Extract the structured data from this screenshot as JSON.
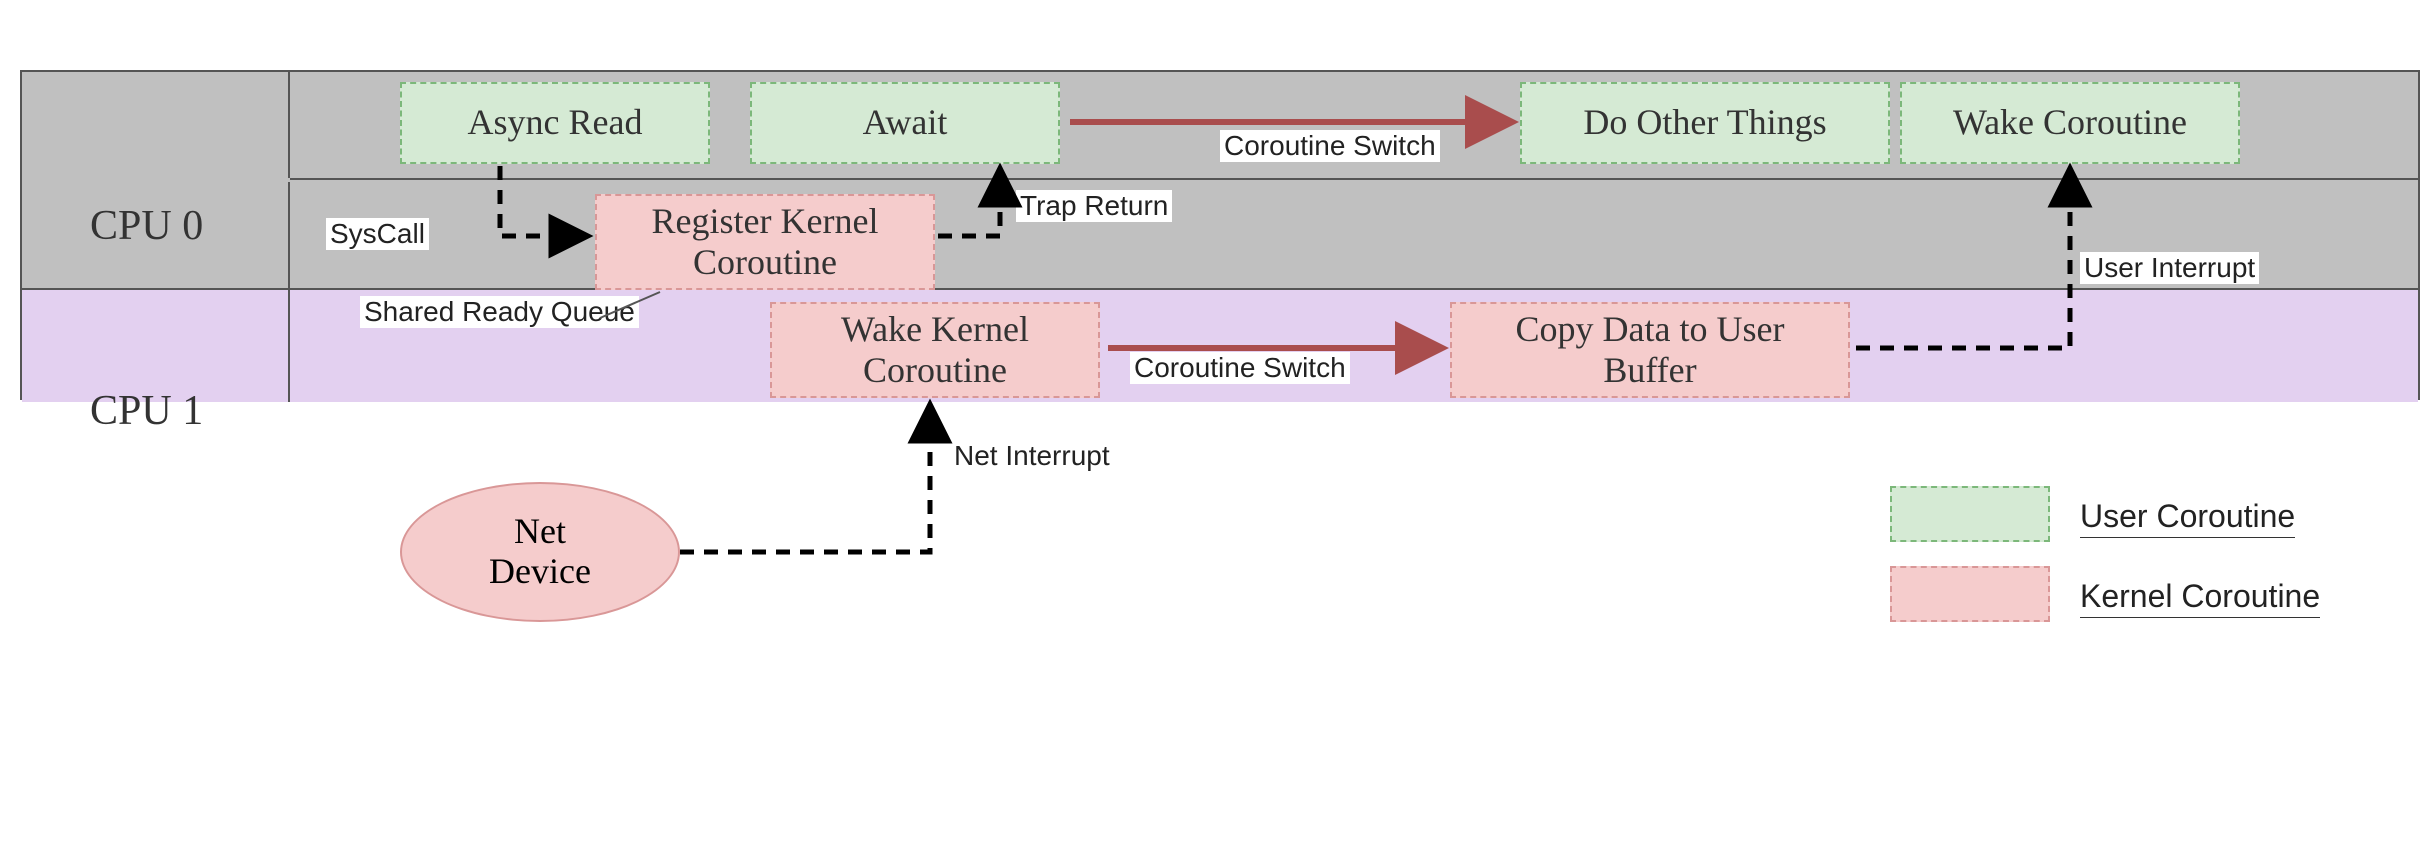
{
  "cpu0": "CPU 0",
  "cpu1": "CPU 1",
  "boxes": {
    "async_read": "Async Read",
    "await": "Await",
    "do_other": "Do Other Things",
    "wake_cor": "Wake Coroutine",
    "reg_kernel": "Register Kernel\nCoroutine",
    "wake_kernel": "Wake Kernel\nCoroutine",
    "copy_data": "Copy Data to User\nBuffer"
  },
  "labels": {
    "syscall": "SysCall",
    "trap_return": "Trap Return",
    "cor_switch1": "Coroutine Switch",
    "cor_switch2": "Coroutine Switch",
    "shared_queue": "Shared Ready Queue",
    "net_interrupt": "Net Interrupt",
    "user_interrupt": "User Interrupt"
  },
  "net_device": "Net\nDevice",
  "legend": {
    "user": "User Coroutine",
    "kernel": "Kernel Coroutine"
  }
}
